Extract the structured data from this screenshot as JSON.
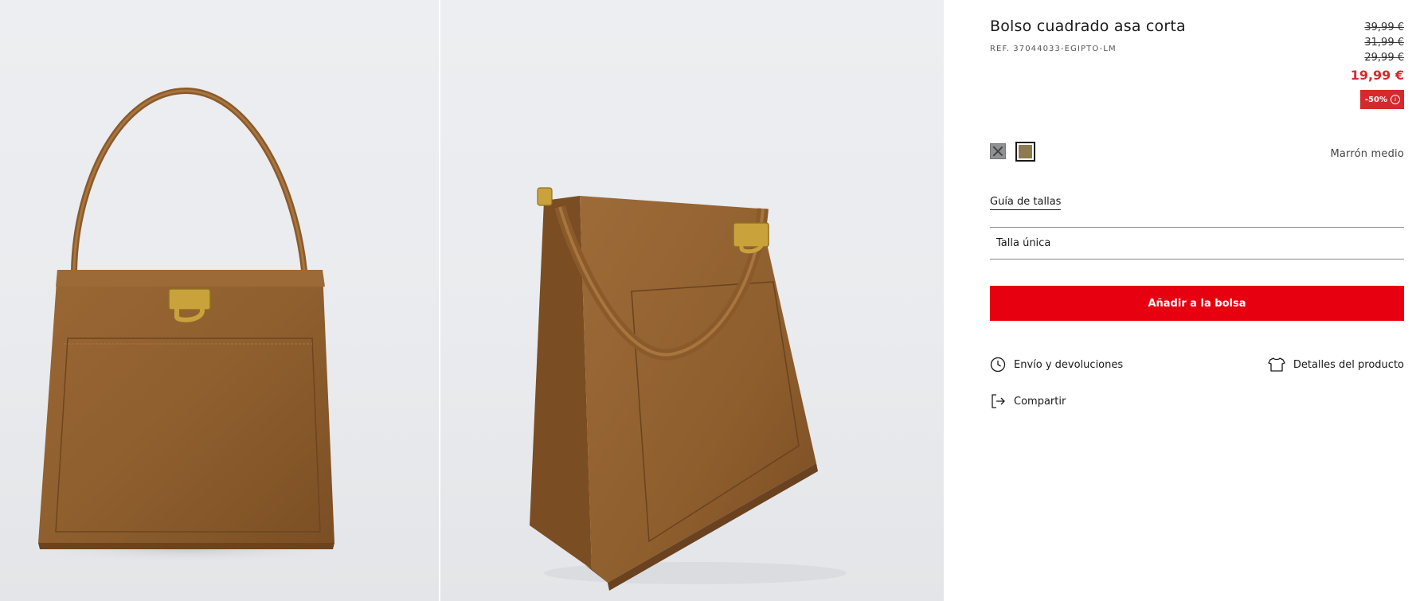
{
  "product": {
    "title": "Bolso cuadrado asa corta",
    "reference": "REF. 37044033-EGIPTO-LM"
  },
  "prices": {
    "previous": [
      "39,99 €",
      "31,99 €",
      "29,99 €"
    ],
    "current": "19,99 €",
    "discount": "-50%",
    "sale_color": "#d42a2f"
  },
  "colors": {
    "swatches": [
      {
        "name": "unavailable-grey",
        "hex": "#8f9193",
        "available": false
      },
      {
        "name": "marron-medio",
        "hex": "#8e7a4f",
        "available": true,
        "selected": true
      }
    ],
    "selected_label": "Marrón medio"
  },
  "size": {
    "guide_label": "Guía de tallas",
    "selected": "Talla única"
  },
  "actions": {
    "add_to_bag": "Añadir a la bolsa",
    "add_to_bag_color": "#e7000f"
  },
  "links": {
    "shipping": "Envío y devoluciones",
    "details": "Detalles del producto",
    "share": "Compartir"
  },
  "icons": {
    "shipping": "clock-icon",
    "details": "tshirt-icon",
    "share": "share-icon",
    "discount_info": "info-icon"
  }
}
